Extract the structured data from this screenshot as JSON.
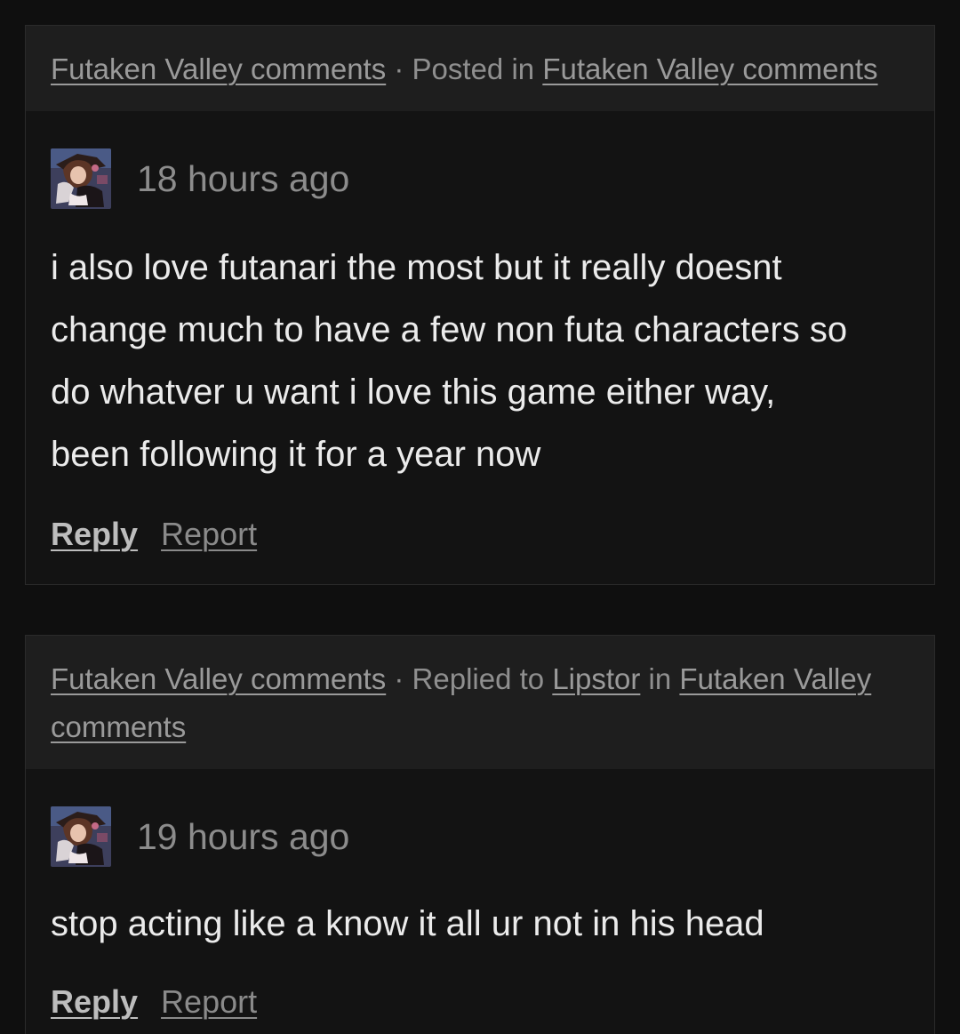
{
  "comments": [
    {
      "header": {
        "source_link": "Futaken Valley comments",
        "separator": " · ",
        "action_text": "Posted in ",
        "target_link": "Futaken Valley comments"
      },
      "avatar_icon": "user-avatar-image",
      "timestamp": "18 hours ago",
      "lines": [
        "i also love futanari the most but it really doesnt",
        "change much to have a few non futa characters so",
        "do whatver u want i love this game either way,",
        "been following it for a year now"
      ],
      "reply_label": "Reply",
      "report_label": "Report"
    },
    {
      "header": {
        "source_link": "Futaken Valley comments",
        "separator": " · ",
        "action_text": "Replied to ",
        "user_link": "Lipstor",
        "in_text": " in ",
        "target_link": "Futaken Valley comments"
      },
      "avatar_icon": "user-avatar-image",
      "timestamp": "19 hours ago",
      "lines": [
        "stop acting like a know it all ur not in his head"
      ],
      "reply_label": "Reply",
      "report_label": "Report"
    }
  ],
  "colors": {
    "page_bg": "#0f0f0f",
    "card_bg": "#131313",
    "header_bg": "#1e1e1e",
    "body_text": "#ebebeb",
    "muted_text": "#8f8f8f"
  }
}
